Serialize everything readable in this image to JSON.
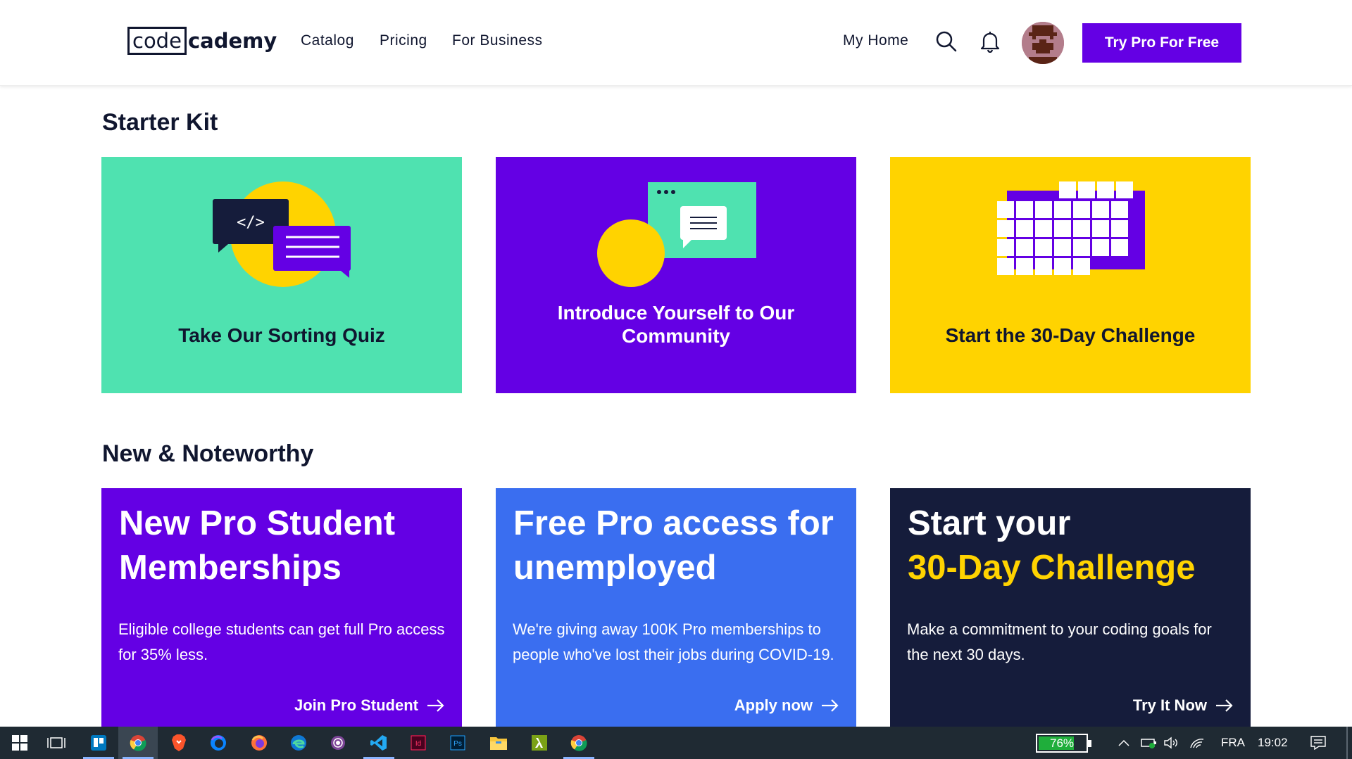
{
  "header": {
    "logo_box": "code",
    "logo_rest": "cademy",
    "nav": [
      "Catalog",
      "Pricing",
      "For Business"
    ],
    "my_home": "My Home",
    "cta": "Try Pro For Free",
    "accent": "#6400e4"
  },
  "starter_kit": {
    "title": "Starter Kit",
    "cards": [
      {
        "label": "Take Our Sorting Quiz",
        "color": "#4fe2b0"
      },
      {
        "label": "Introduce Yourself to Our Community",
        "color": "#6400e4"
      },
      {
        "label": "Start the 30-Day Challenge",
        "color": "#ffd300"
      }
    ],
    "quiz_code_glyph": "</>"
  },
  "noteworthy": {
    "title": "New & Noteworthy",
    "cards": [
      {
        "title_line1": "New Pro Student",
        "title_line2": "Memberships",
        "body": "Eligible college students can get full Pro access for 35% less.",
        "link": "Join Pro Student",
        "color": "#6400e4"
      },
      {
        "title_line1": "Free Pro access for",
        "title_line2": "unemployed",
        "body": "We're giving away 100K Pro memberships to people who've lost their jobs during COVID-19.",
        "link": "Apply now",
        "color": "#3a6ef0"
      },
      {
        "title_line1": "Start your",
        "title_line2": "30-Day Challenge",
        "body": "Make a commitment to your coding goals for the next 30 days.",
        "link": "Try It Now",
        "color": "#151c3b",
        "highlight": "#ffd300"
      }
    ]
  },
  "taskbar": {
    "battery": "76%",
    "battery_level": 0.76,
    "language": "FRA",
    "time": "19:02",
    "apps": [
      "windows-start",
      "task-view",
      "trello",
      "chrome",
      "brave",
      "firefox-dev",
      "firefox",
      "edge",
      "tor-browser",
      "vscode",
      "indesign",
      "photoshop",
      "file-explorer",
      "lambda-app",
      "chrome-2"
    ]
  }
}
